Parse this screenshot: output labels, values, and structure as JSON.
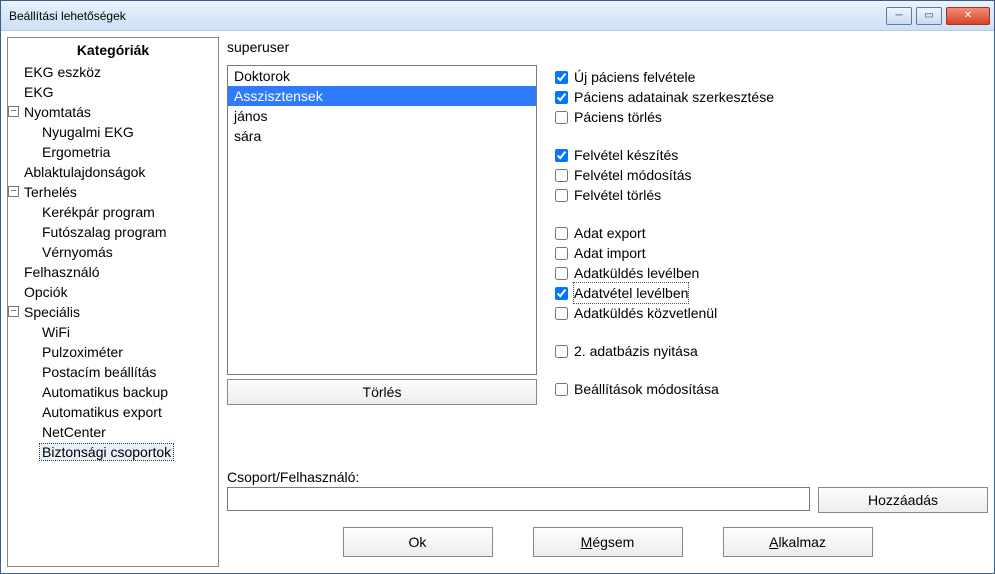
{
  "window": {
    "title": "Beállítási lehetőségek"
  },
  "sidebar": {
    "title": "Kategóriák",
    "tree": [
      {
        "label": "EKG eszköz",
        "children": []
      },
      {
        "label": "EKG",
        "children": []
      },
      {
        "label": "Nyomtatás",
        "expanded": true,
        "children": [
          {
            "label": "Nyugalmi EKG"
          },
          {
            "label": "Ergometria"
          }
        ]
      },
      {
        "label": "Ablaktulajdonságok",
        "children": []
      },
      {
        "label": "Terhelés",
        "expanded": true,
        "children": [
          {
            "label": "Kerékpár program"
          },
          {
            "label": "Futószalag program"
          },
          {
            "label": "Vérnyomás"
          }
        ]
      },
      {
        "label": "Felhasználó",
        "children": []
      },
      {
        "label": "Opciók",
        "children": []
      },
      {
        "label": "Speciális",
        "expanded": true,
        "children": [
          {
            "label": "WiFi"
          },
          {
            "label": "Pulzoximéter"
          },
          {
            "label": "Postacím beállítás"
          },
          {
            "label": "Automatikus backup"
          },
          {
            "label": "Automatikus export"
          },
          {
            "label": "NetCenter"
          },
          {
            "label": "Biztonsági csoportok",
            "selected": true
          }
        ]
      }
    ]
  },
  "content": {
    "user_label": "superuser",
    "list": {
      "items": [
        "Doktorok",
        "Asszisztensek",
        "jános",
        "sára"
      ],
      "selected_index": 1,
      "delete_label": "Törlés"
    },
    "permissions": {
      "groups": [
        [
          {
            "label": "Új páciens felvétele",
            "checked": true
          },
          {
            "label": "Páciens adatainak szerkesztése",
            "checked": true
          },
          {
            "label": "Páciens törlés",
            "checked": false
          }
        ],
        [
          {
            "label": "Felvétel készítés",
            "checked": true
          },
          {
            "label": "Felvétel módosítás",
            "checked": false
          },
          {
            "label": "Felvétel törlés",
            "checked": false
          }
        ],
        [
          {
            "label": "Adat export",
            "checked": false
          },
          {
            "label": "Adat import",
            "checked": false
          },
          {
            "label": "Adatküldés levélben",
            "checked": false
          },
          {
            "label": "Adatvétel levélben",
            "checked": true,
            "focused": true
          },
          {
            "label": "Adatküldés közvetlenül",
            "checked": false
          }
        ],
        [
          {
            "label": "2. adatbázis nyitása",
            "checked": false
          }
        ],
        [
          {
            "label": "Beállítások módosítása",
            "checked": false
          }
        ]
      ]
    },
    "add": {
      "label": "Csoport/Felhasználó:",
      "value": "",
      "button": "Hozzáadás"
    }
  },
  "buttons": {
    "ok": "Ok",
    "cancel_pre": "",
    "cancel_u": "M",
    "cancel_post": "égsem",
    "apply_pre": "",
    "apply_u": "A",
    "apply_post": "lkalmaz"
  }
}
